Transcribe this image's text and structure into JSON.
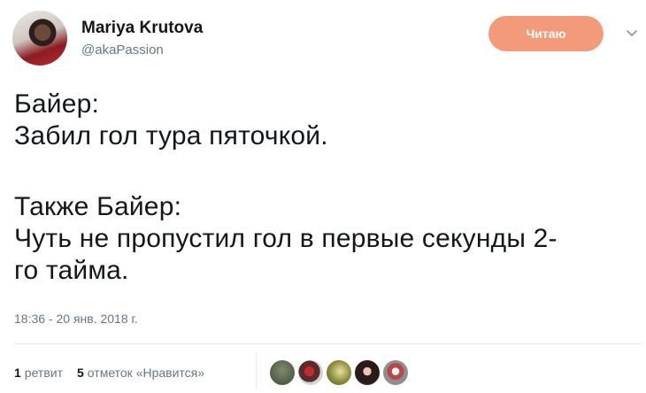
{
  "author": {
    "name": "Mariya Krutova",
    "handle": "@akaPassion"
  },
  "header": {
    "follow_label": "Читаю",
    "follow_color": "#f29a7a"
  },
  "tweet": {
    "lines": [
      "Байер:",
      "Забил гол тура пяточкой.",
      "",
      "Также Байер:",
      "Чуть не пропустил гол в первые секунды 2-",
      "го тайма."
    ],
    "timestamp": "18:36 - 20 янв. 2018 г."
  },
  "stats": {
    "retweets_count": "1",
    "retweets_label": "ретвит",
    "likes_count": "5",
    "likes_label": "отметок «Нравится»"
  },
  "icons": {
    "more": "chevron-down-icon"
  },
  "colors": {
    "text": "#14171a",
    "secondary": "#657786",
    "divider": "#e6ecf0"
  }
}
